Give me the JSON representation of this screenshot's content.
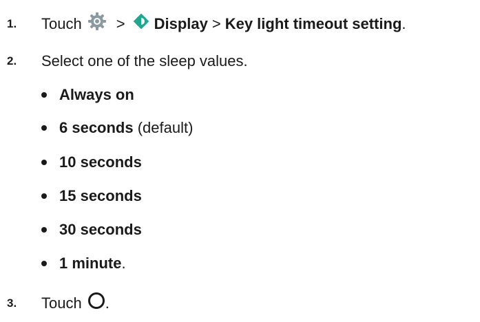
{
  "steps": [
    {
      "number": "1.",
      "text_before": "Touch",
      "gear_icon": "settings-gear-icon",
      "separator1": ">",
      "display_icon": "display-brightness-icon",
      "display_label": "Display",
      "separator2": ">",
      "setting_label": "Key light timeout setting",
      "trailing": "."
    },
    {
      "number": "2.",
      "text": "Select one of the sleep values."
    },
    {
      "number": "3.",
      "text_before": "Touch",
      "circle_icon": "home-circle-icon",
      "trailing": "."
    }
  ],
  "options": [
    {
      "bold": "Always on",
      "suffix": ""
    },
    {
      "bold": "6 seconds",
      "suffix": " (default)"
    },
    {
      "bold": "10 seconds",
      "suffix": ""
    },
    {
      "bold": "15 seconds",
      "suffix": ""
    },
    {
      "bold": "30 seconds",
      "suffix": ""
    },
    {
      "bold": "1 minute",
      "suffix": "."
    }
  ],
  "colors": {
    "gear": "#8a9aa0",
    "display_icon": "#1ea890",
    "text": "#1a1a1a"
  }
}
